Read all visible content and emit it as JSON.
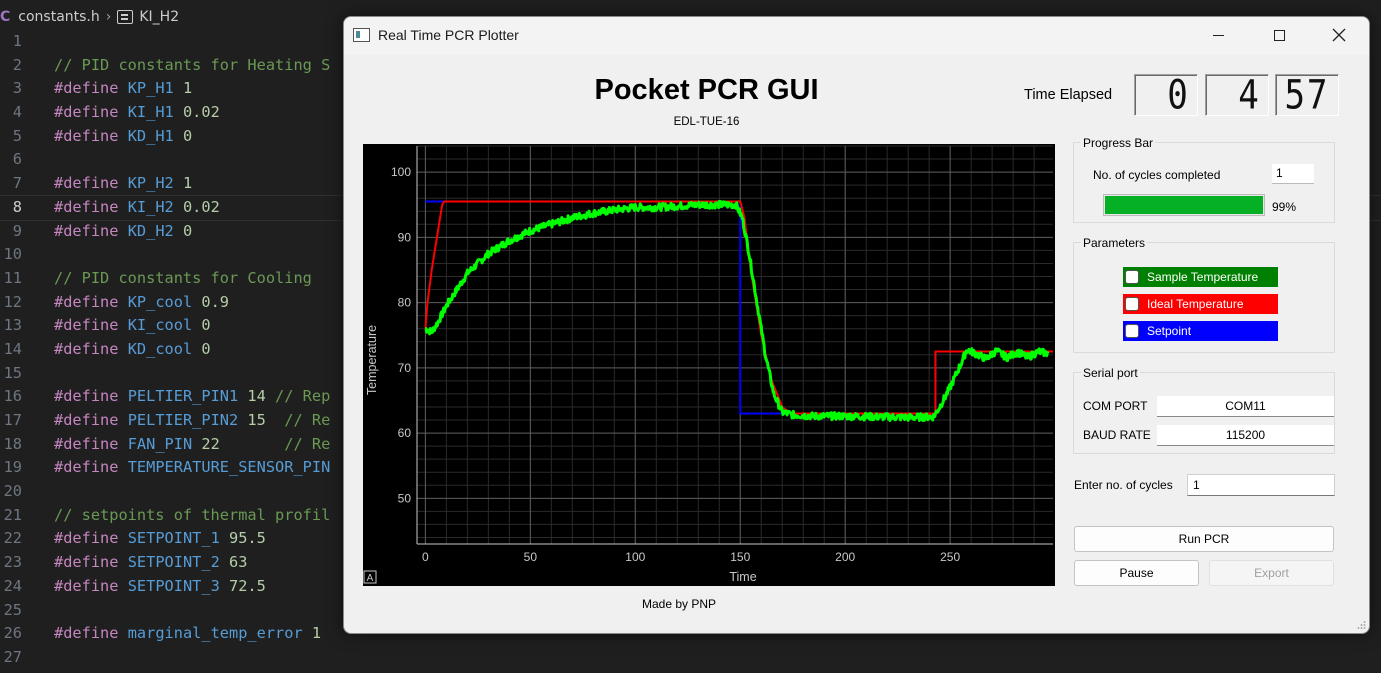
{
  "editor": {
    "breadcrumb": {
      "file_icon": "C",
      "file": "constants.h",
      "symbol": "KI_H2"
    },
    "current_line": 8,
    "lines": [
      {
        "n": "1",
        "tokens": []
      },
      {
        "n": "2",
        "tokens": [
          {
            "c": "cm",
            "t": "// PID constants for Heating S"
          }
        ]
      },
      {
        "n": "3",
        "tokens": [
          {
            "c": "kw",
            "t": "#define "
          },
          {
            "c": "mc",
            "t": "KP_H1"
          },
          {
            "c": "pl",
            "t": " "
          },
          {
            "c": "num",
            "t": "1"
          }
        ]
      },
      {
        "n": "4",
        "tokens": [
          {
            "c": "kw",
            "t": "#define "
          },
          {
            "c": "mc",
            "t": "KI_H1"
          },
          {
            "c": "pl",
            "t": " "
          },
          {
            "c": "num",
            "t": "0.02"
          }
        ]
      },
      {
        "n": "5",
        "tokens": [
          {
            "c": "kw",
            "t": "#define "
          },
          {
            "c": "mc",
            "t": "KD_H1"
          },
          {
            "c": "pl",
            "t": " "
          },
          {
            "c": "num",
            "t": "0"
          }
        ]
      },
      {
        "n": "6",
        "tokens": []
      },
      {
        "n": "7",
        "tokens": [
          {
            "c": "kw",
            "t": "#define "
          },
          {
            "c": "mc",
            "t": "KP_H2"
          },
          {
            "c": "pl",
            "t": " "
          },
          {
            "c": "num",
            "t": "1"
          }
        ]
      },
      {
        "n": "8",
        "tokens": [
          {
            "c": "kw",
            "t": "#define "
          },
          {
            "c": "mc",
            "t": "KI_H2"
          },
          {
            "c": "pl",
            "t": " "
          },
          {
            "c": "num",
            "t": "0.02"
          }
        ]
      },
      {
        "n": "9",
        "tokens": [
          {
            "c": "kw",
            "t": "#define "
          },
          {
            "c": "mc",
            "t": "KD_H2"
          },
          {
            "c": "pl",
            "t": " "
          },
          {
            "c": "num",
            "t": "0"
          }
        ]
      },
      {
        "n": "10",
        "tokens": []
      },
      {
        "n": "11",
        "tokens": [
          {
            "c": "cm",
            "t": "// PID constants for Cooling"
          }
        ]
      },
      {
        "n": "12",
        "tokens": [
          {
            "c": "kw",
            "t": "#define "
          },
          {
            "c": "mc",
            "t": "KP_cool"
          },
          {
            "c": "pl",
            "t": " "
          },
          {
            "c": "num",
            "t": "0.9"
          }
        ]
      },
      {
        "n": "13",
        "tokens": [
          {
            "c": "kw",
            "t": "#define "
          },
          {
            "c": "mc",
            "t": "KI_cool"
          },
          {
            "c": "pl",
            "t": " "
          },
          {
            "c": "num",
            "t": "0"
          }
        ]
      },
      {
        "n": "14",
        "tokens": [
          {
            "c": "kw",
            "t": "#define "
          },
          {
            "c": "mc",
            "t": "KD_cool"
          },
          {
            "c": "pl",
            "t": " "
          },
          {
            "c": "num",
            "t": "0"
          }
        ]
      },
      {
        "n": "15",
        "tokens": []
      },
      {
        "n": "16",
        "tokens": [
          {
            "c": "kw",
            "t": "#define "
          },
          {
            "c": "mc",
            "t": "PELTIER_PIN1"
          },
          {
            "c": "pl",
            "t": " "
          },
          {
            "c": "num",
            "t": "14"
          },
          {
            "c": "cm",
            "t": " // Rep"
          }
        ]
      },
      {
        "n": "17",
        "tokens": [
          {
            "c": "kw",
            "t": "#define "
          },
          {
            "c": "mc",
            "t": "PELTIER_PIN2"
          },
          {
            "c": "pl",
            "t": " "
          },
          {
            "c": "num",
            "t": "15"
          },
          {
            "c": "cm",
            "t": "  // Re"
          }
        ]
      },
      {
        "n": "18",
        "tokens": [
          {
            "c": "kw",
            "t": "#define "
          },
          {
            "c": "mc",
            "t": "FAN_PIN"
          },
          {
            "c": "pl",
            "t": " "
          },
          {
            "c": "num",
            "t": "22"
          },
          {
            "c": "cm",
            "t": "       // Re"
          }
        ]
      },
      {
        "n": "19",
        "tokens": [
          {
            "c": "kw",
            "t": "#define "
          },
          {
            "c": "mc",
            "t": "TEMPERATURE_SENSOR_PIN"
          }
        ]
      },
      {
        "n": "20",
        "tokens": []
      },
      {
        "n": "21",
        "tokens": [
          {
            "c": "cm",
            "t": "// setpoints of thermal profil"
          }
        ]
      },
      {
        "n": "22",
        "tokens": [
          {
            "c": "kw",
            "t": "#define "
          },
          {
            "c": "mc",
            "t": "SETPOINT_1"
          },
          {
            "c": "pl",
            "t": " "
          },
          {
            "c": "num",
            "t": "95.5"
          }
        ]
      },
      {
        "n": "23",
        "tokens": [
          {
            "c": "kw",
            "t": "#define "
          },
          {
            "c": "mc",
            "t": "SETPOINT_2"
          },
          {
            "c": "pl",
            "t": " "
          },
          {
            "c": "num",
            "t": "63"
          }
        ]
      },
      {
        "n": "24",
        "tokens": [
          {
            "c": "kw",
            "t": "#define "
          },
          {
            "c": "mc",
            "t": "SETPOINT_3"
          },
          {
            "c": "pl",
            "t": " "
          },
          {
            "c": "num",
            "t": "72.5"
          }
        ]
      },
      {
        "n": "25",
        "tokens": []
      },
      {
        "n": "26",
        "tokens": [
          {
            "c": "kw",
            "t": "#define "
          },
          {
            "c": "mc",
            "t": "marginal_temp_error"
          },
          {
            "c": "pl",
            "t": " "
          },
          {
            "c": "num",
            "t": "1"
          }
        ]
      },
      {
        "n": "27",
        "tokens": []
      }
    ]
  },
  "window": {
    "title": "Real Time PCR Plotter",
    "app_title": "Pocket PCR GUI",
    "subtitle": "EDL-TUE-16",
    "time_label": "Time Elapsed",
    "time": {
      "hours": "0",
      "minutes": "4",
      "seconds": "57"
    },
    "made_by": "Made by PNP",
    "progress": {
      "group_title": "Progress Bar",
      "cycles_label": "No. of cycles completed",
      "cycles_value": "1",
      "percent": 99,
      "percent_text": "99%"
    },
    "parameters": {
      "group_title": "Parameters",
      "items": [
        {
          "label": "Sample Temperature",
          "color": "#008000",
          "checked": false
        },
        {
          "label": "Ideal Temperature",
          "color": "#ff0000",
          "checked": false
        },
        {
          "label": "Setpoint",
          "color": "#0000ff",
          "checked": false
        }
      ]
    },
    "serial": {
      "group_title": "Serial port",
      "com_label": "COM PORT",
      "com_value": "COM11",
      "baud_label": "BAUD RATE",
      "baud_value": "115200"
    },
    "cycles_input": {
      "label": "Enter no. of cycles",
      "value": "1"
    },
    "buttons": {
      "run": "Run PCR",
      "pause": "Pause",
      "export": "Export"
    },
    "plot_auto_button": "A"
  },
  "chart_data": {
    "type": "line",
    "xlabel": "Time",
    "ylabel": "Temperature",
    "xlim": [
      -4,
      299
    ],
    "ylim": [
      43,
      104
    ],
    "xticks": [
      0,
      50,
      100,
      150,
      200,
      250
    ],
    "yticks": [
      50,
      60,
      70,
      80,
      90,
      100
    ],
    "grid": true,
    "background": "#000000",
    "series": [
      {
        "name": "Setpoint",
        "color": "#0000ff",
        "x": [
          0,
          150,
          150,
          243,
          243
        ],
        "y": [
          95.5,
          95.5,
          63,
          63,
          72.5
        ]
      },
      {
        "name": "Ideal Temperature",
        "color": "#ff0000",
        "x": [
          0,
          1,
          3,
          5,
          7,
          8,
          9,
          150,
          152,
          155,
          160,
          165,
          170,
          174,
          243,
          243,
          299
        ],
        "y": [
          76,
          80,
          85,
          89,
          93,
          95,
          95.5,
          95.5,
          93,
          85,
          75,
          68,
          64,
          63,
          63,
          72.5,
          72.5
        ]
      },
      {
        "name": "Sample Temperature",
        "color": "#00ff00",
        "x": [
          0,
          3,
          6,
          10,
          15,
          20,
          30,
          40,
          50,
          60,
          70,
          80,
          90,
          100,
          110,
          120,
          130,
          140,
          148,
          151,
          154,
          158,
          162,
          166,
          170,
          175,
          185,
          200,
          215,
          230,
          242,
          245,
          250,
          255,
          258,
          262,
          267,
          272,
          277,
          282,
          287,
          292,
          297
        ],
        "y": [
          76,
          75.5,
          77,
          79.5,
          82,
          84.5,
          87.5,
          89.5,
          91,
          92,
          93,
          93.7,
          94.2,
          94.6,
          94.6,
          94.8,
          95,
          95,
          95,
          93,
          88,
          80,
          72,
          66,
          63.2,
          62.8,
          62.6,
          62.6,
          62.5,
          62.4,
          62.5,
          64,
          67,
          70.5,
          72.8,
          72.2,
          71.4,
          72.6,
          71.6,
          72.4,
          71.6,
          72.5,
          72.2
        ]
      }
    ]
  }
}
